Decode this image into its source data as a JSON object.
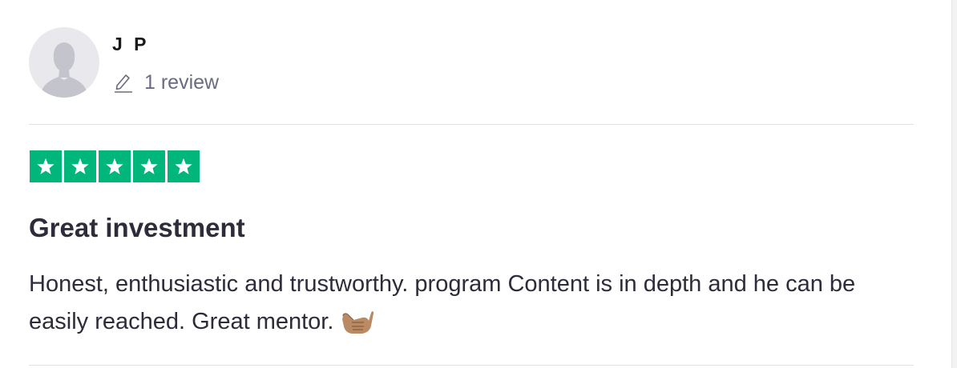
{
  "review": {
    "consumer_name": "J P",
    "review_count_label": "1 review",
    "rating": 5,
    "rating_max": 5,
    "title": "Great investment",
    "body": "Honest, enthusiastic and trustworthy. program Content is in depth and he can be easily reached. Great mentor.",
    "emoji_icon": "call-me-hand-icon"
  },
  "colors": {
    "star_green": "#00b67a",
    "text_dark": "#2c2c3a",
    "text_muted": "#6b6b80",
    "avatar_bg": "#e9e9ed",
    "divider": "#e0e0e0"
  },
  "icons": {
    "avatar": "person-silhouette-icon",
    "reviews": "pencil-icon",
    "star": "star-icon"
  }
}
